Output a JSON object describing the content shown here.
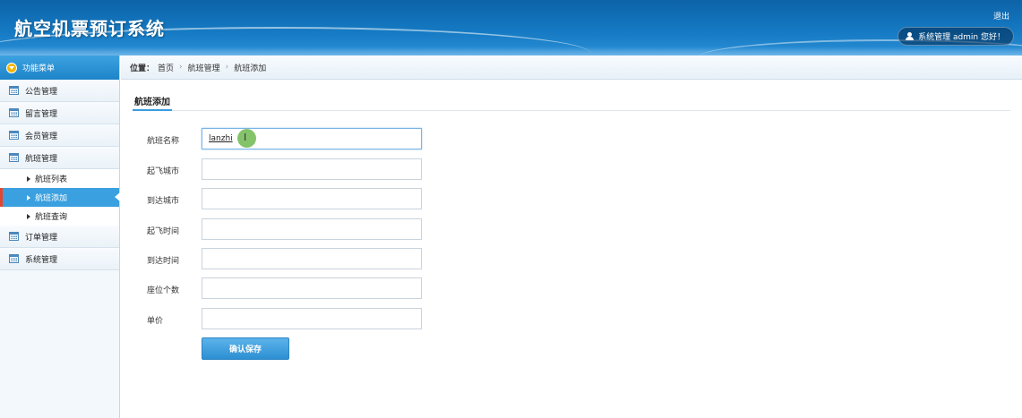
{
  "header": {
    "title": "航空机票预订系统",
    "logout": "退出",
    "user_greeting": "系统管理 admin 您好！"
  },
  "sidebar": {
    "title": "功能菜单",
    "items": [
      {
        "label": "公告管理"
      },
      {
        "label": "留言管理"
      },
      {
        "label": "会员管理"
      },
      {
        "label": "航班管理"
      },
      {
        "label": "订单管理"
      },
      {
        "label": "系统管理"
      }
    ],
    "flight_sub": [
      {
        "label": "航班列表"
      },
      {
        "label": "航班添加"
      },
      {
        "label": "航班查询"
      }
    ]
  },
  "breadcrumb": {
    "prefix": "位置：",
    "items": [
      "首页",
      "航班管理",
      "航班添加"
    ],
    "separator": "›"
  },
  "tab": {
    "label": "航班添加"
  },
  "form": {
    "fields": [
      {
        "label": "航班名称",
        "value": "lanzhi"
      },
      {
        "label": "起飞城市",
        "value": ""
      },
      {
        "label": "到达城市",
        "value": ""
      },
      {
        "label": "起飞时间",
        "value": ""
      },
      {
        "label": "到达时间",
        "value": ""
      },
      {
        "label": "座位个数",
        "value": ""
      },
      {
        "label": "单价",
        "value": ""
      }
    ],
    "submit_label": "确认保存"
  }
}
